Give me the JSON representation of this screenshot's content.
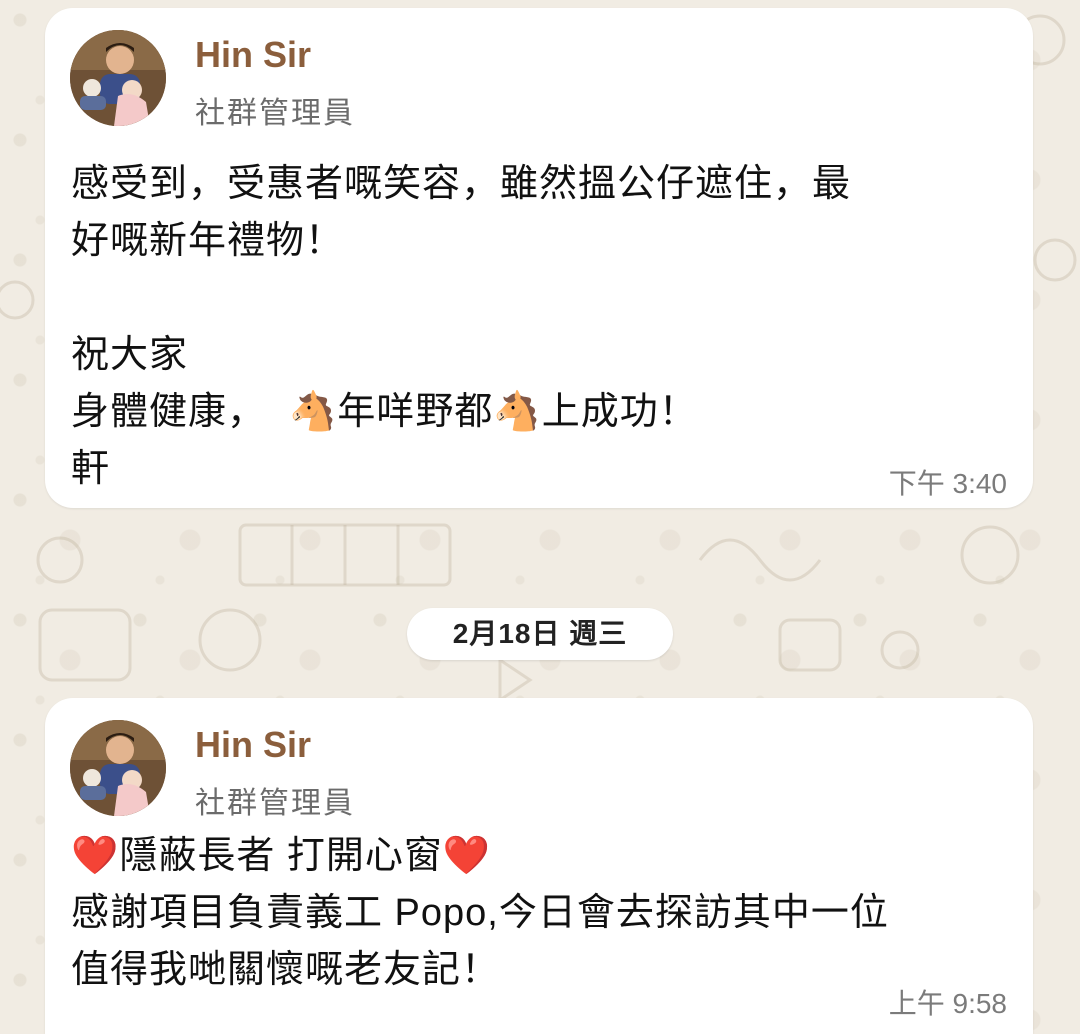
{
  "messages": [
    {
      "sender": "Hin Sir",
      "role": "社群管理員",
      "text": "感受到，受惠者嘅笑容，雖然搵公仔遮住，最\n好嘅新年禮物！\n\n祝大家\n身體健康，  🐴年咩野都🐴上成功！\n軒",
      "time": "下午 3:40"
    },
    {
      "sender": "Hin Sir",
      "role": "社群管理員",
      "text": "❤️隱蔽長者 打開心窗❤️\n感謝項目負責義工 Popo,今日會去探訪其中一位\n值得我哋關懷嘅老友記！",
      "time": "上午 9:58"
    }
  ],
  "date_divider": "2月18日 週三",
  "colors": {
    "background": "#f1ece3",
    "bubble": "#ffffff",
    "sender_name": "#8b5e3c",
    "role": "#6b6b6b",
    "timestamp": "#7b7b7b"
  },
  "icons": {
    "avatar": "avatar-photo"
  }
}
